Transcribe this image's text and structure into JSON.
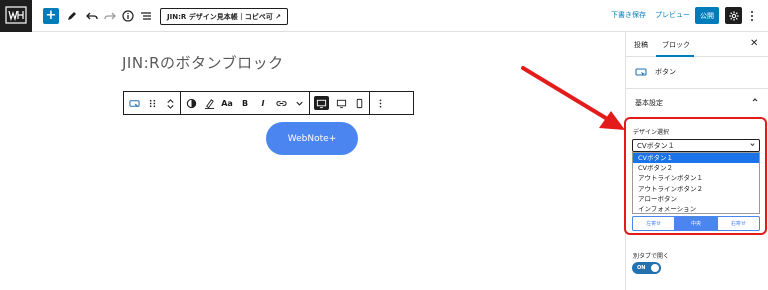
{
  "topbar": {
    "doc_title": "JIN:R デザイン見本帳｜コピペ可 ↗",
    "draft_label": "下書き保存",
    "preview_label": "プレビュー",
    "publish_label": "公開",
    "add_label": "+"
  },
  "editor": {
    "title": "JIN:Rのボタンブロック",
    "button_text": "WebNote+",
    "toolbar_text": {
      "font_size": "Aa",
      "bold": "B",
      "italic": "I"
    }
  },
  "sidebar": {
    "tabs": [
      "投稿",
      "ブロック"
    ],
    "close": "✕",
    "block_name": "ボタン",
    "section_title": "基本設定",
    "design_label": "デザイン選択",
    "select_value": "CVボタン１",
    "options": [
      "CVボタン１",
      "CVボタン２",
      "アウトラインボタン１",
      "アウトラインボタン２",
      "アローボタン",
      "インフォメーション"
    ],
    "selected_index": 0,
    "align_buttons": [
      "左寄せ",
      "中央",
      "右寄せ"
    ],
    "newtab_label": "別タブで開く",
    "toggle_label": "ON"
  },
  "colors": {
    "accent": "#007cba",
    "button_blue": "#4b86f0",
    "highlight_red": "#e31b1b",
    "arrow_red": "#e31b1b"
  },
  "icons": [
    "logo-icon",
    "add-icon",
    "pen-icon",
    "undo-icon",
    "redo-icon",
    "info-icon",
    "list-view-icon",
    "gear-icon",
    "kebab-icon",
    "button-block-icon",
    "drag-icon",
    "move-arrows-icon",
    "style-icon",
    "highlight-icon",
    "link-icon",
    "chevron-down-icon",
    "desktop-icon",
    "tablet-icon",
    "mobile-icon",
    "chevron-up-icon"
  ]
}
